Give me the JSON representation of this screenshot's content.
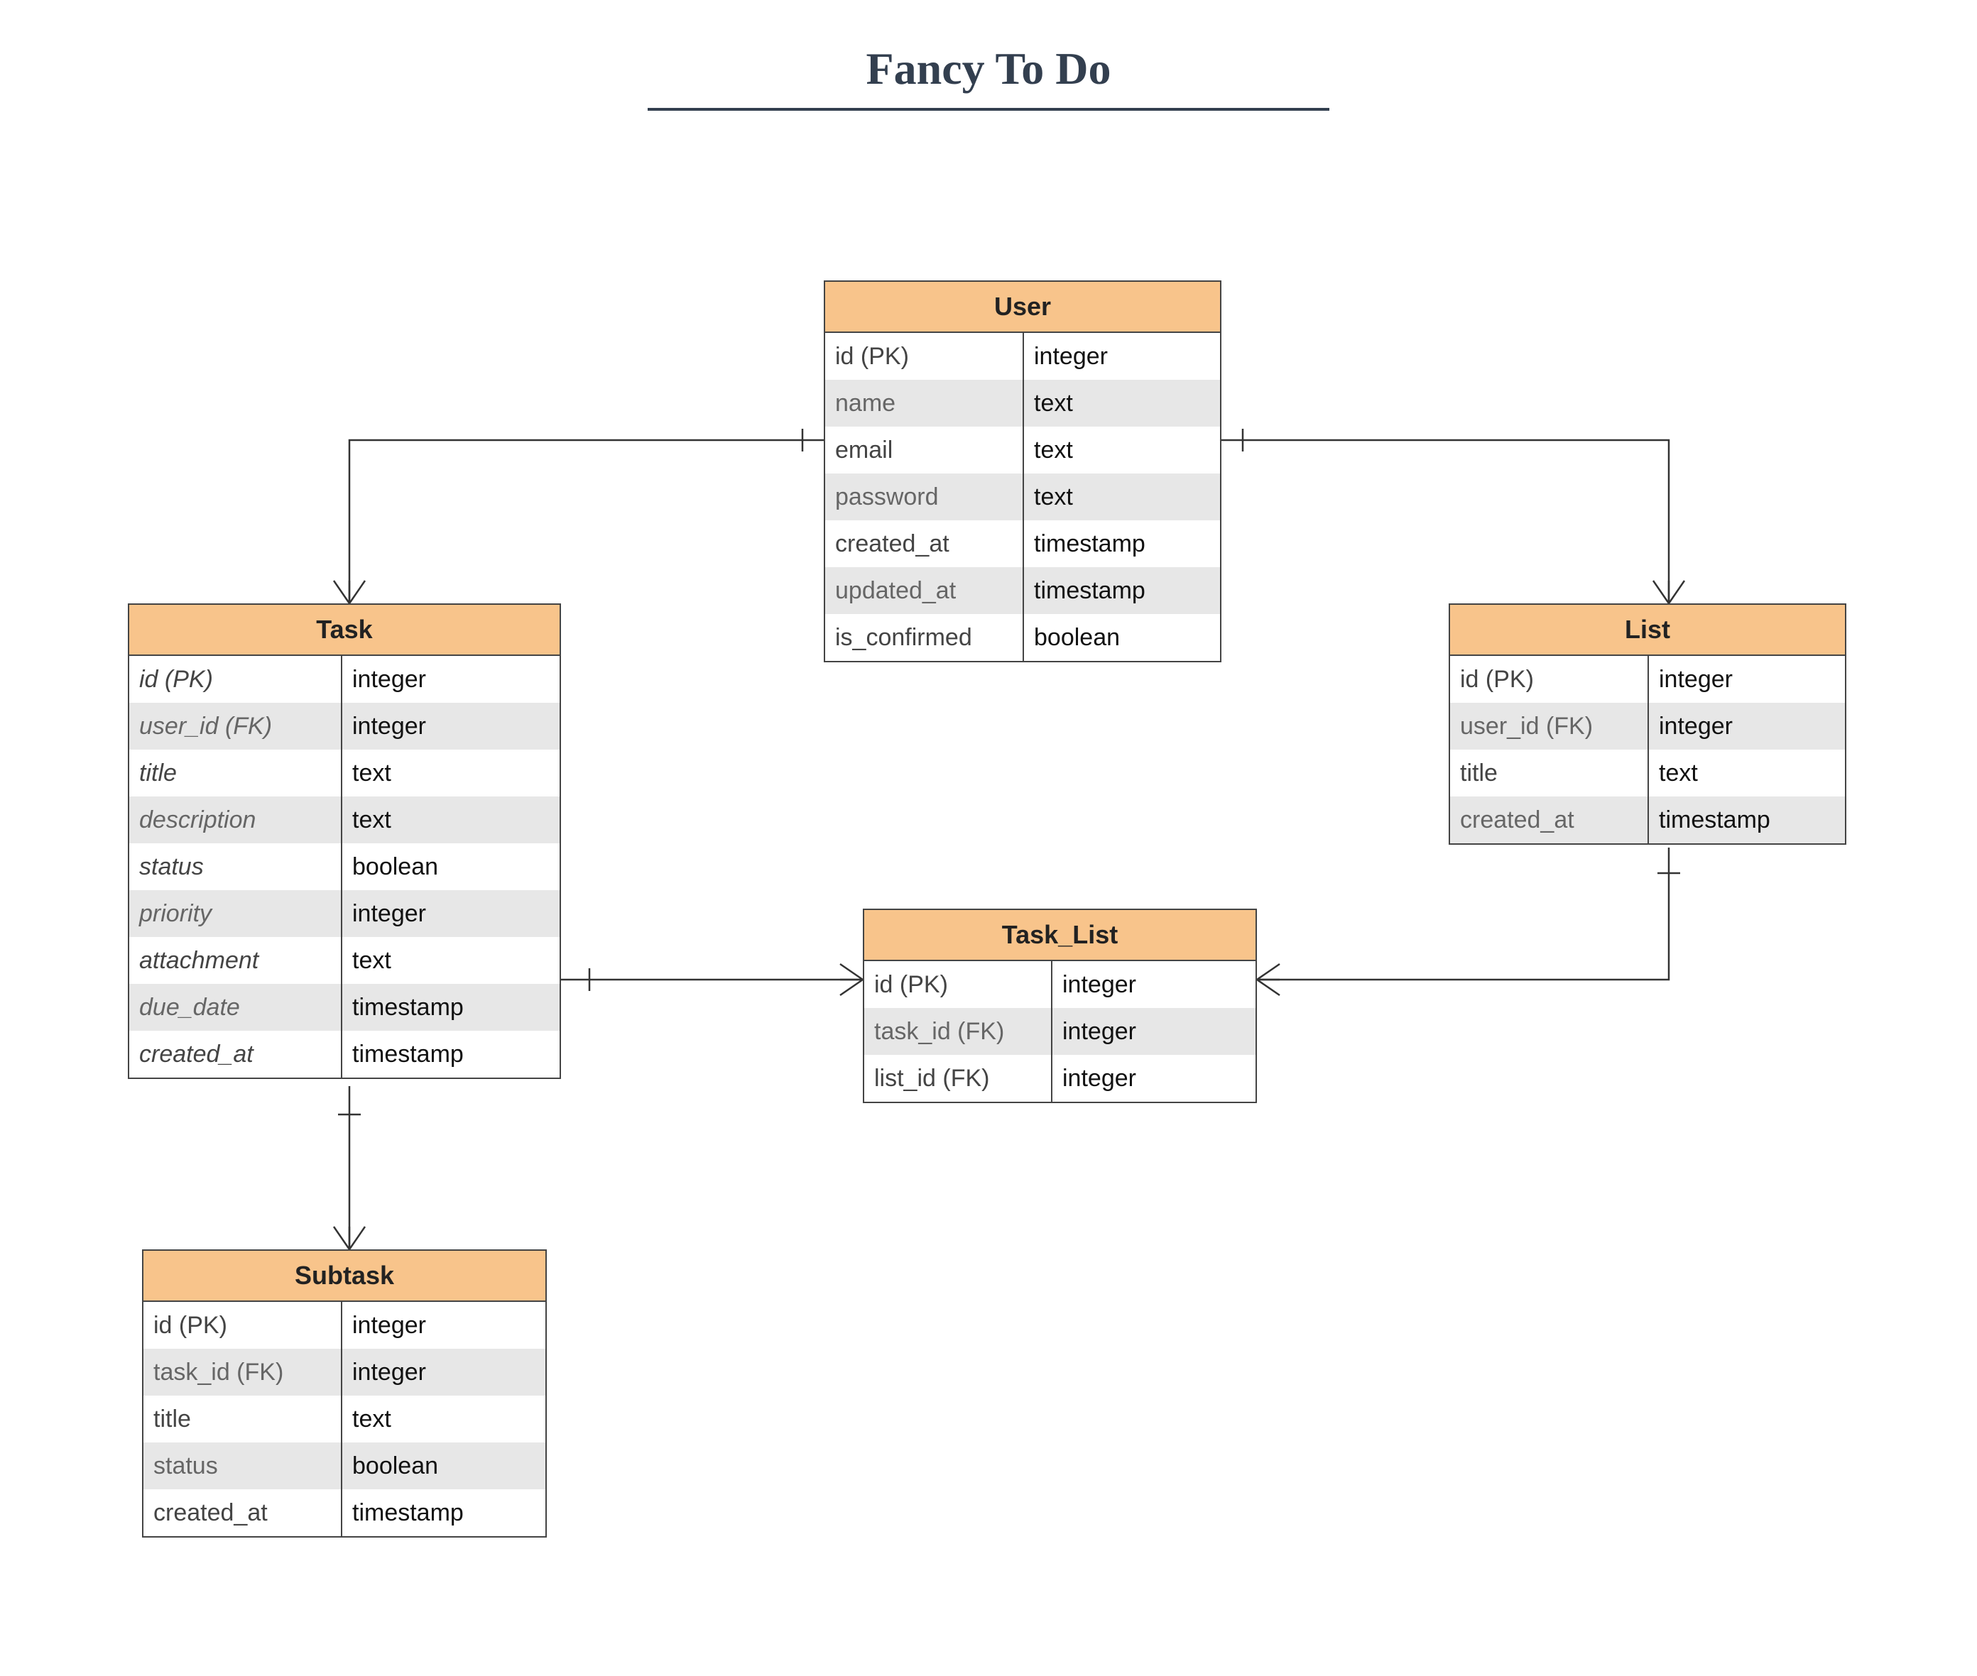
{
  "title": "Fancy To Do",
  "entities": {
    "user": {
      "name": "User",
      "fields": [
        {
          "name": "id (PK)",
          "type": "integer"
        },
        {
          "name": "name",
          "type": "text"
        },
        {
          "name": "email",
          "type": "text"
        },
        {
          "name": "password",
          "type": "text"
        },
        {
          "name": "created_at",
          "type": "timestamp"
        },
        {
          "name": "updated_at",
          "type": "timestamp"
        },
        {
          "name": "is_confirmed",
          "type": "boolean"
        }
      ]
    },
    "task": {
      "name": "Task",
      "fields": [
        {
          "name": "id (PK)",
          "type": "integer",
          "italic": true
        },
        {
          "name": "user_id (FK)",
          "type": "integer",
          "italic": true
        },
        {
          "name": "title",
          "type": "text",
          "italic": true
        },
        {
          "name": "description",
          "type": "text",
          "italic": true
        },
        {
          "name": "status",
          "type": "boolean",
          "italic": true
        },
        {
          "name": "priority",
          "type": "integer",
          "italic": true
        },
        {
          "name": "attachment",
          "type": "text",
          "italic": true
        },
        {
          "name": "due_date",
          "type": "timestamp",
          "italic": true
        },
        {
          "name": "created_at",
          "type": "timestamp",
          "italic": true
        }
      ]
    },
    "list": {
      "name": "List",
      "fields": [
        {
          "name": "id (PK)",
          "type": "integer"
        },
        {
          "name": "user_id (FK)",
          "type": "integer"
        },
        {
          "name": "title",
          "type": "text"
        },
        {
          "name": "created_at",
          "type": "timestamp"
        }
      ]
    },
    "tasklist": {
      "name": "Task_List",
      "fields": [
        {
          "name": "id (PK)",
          "type": "integer"
        },
        {
          "name": "task_id (FK)",
          "type": "integer"
        },
        {
          "name": "list_id (FK)",
          "type": "integer"
        }
      ]
    },
    "subtask": {
      "name": "Subtask",
      "fields": [
        {
          "name": "id (PK)",
          "type": "integer"
        },
        {
          "name": "task_id (FK)",
          "type": "integer"
        },
        {
          "name": "title",
          "type": "text"
        },
        {
          "name": "status",
          "type": "boolean"
        },
        {
          "name": "created_at",
          "type": "timestamp"
        }
      ]
    }
  },
  "relationships": [
    {
      "from": "User",
      "to": "Task",
      "type": "one-to-many"
    },
    {
      "from": "User",
      "to": "List",
      "type": "one-to-many"
    },
    {
      "from": "Task",
      "to": "Subtask",
      "type": "one-to-many"
    },
    {
      "from": "Task",
      "to": "Task_List",
      "type": "one-to-many"
    },
    {
      "from": "List",
      "to": "Task_List",
      "type": "one-to-many"
    }
  ]
}
